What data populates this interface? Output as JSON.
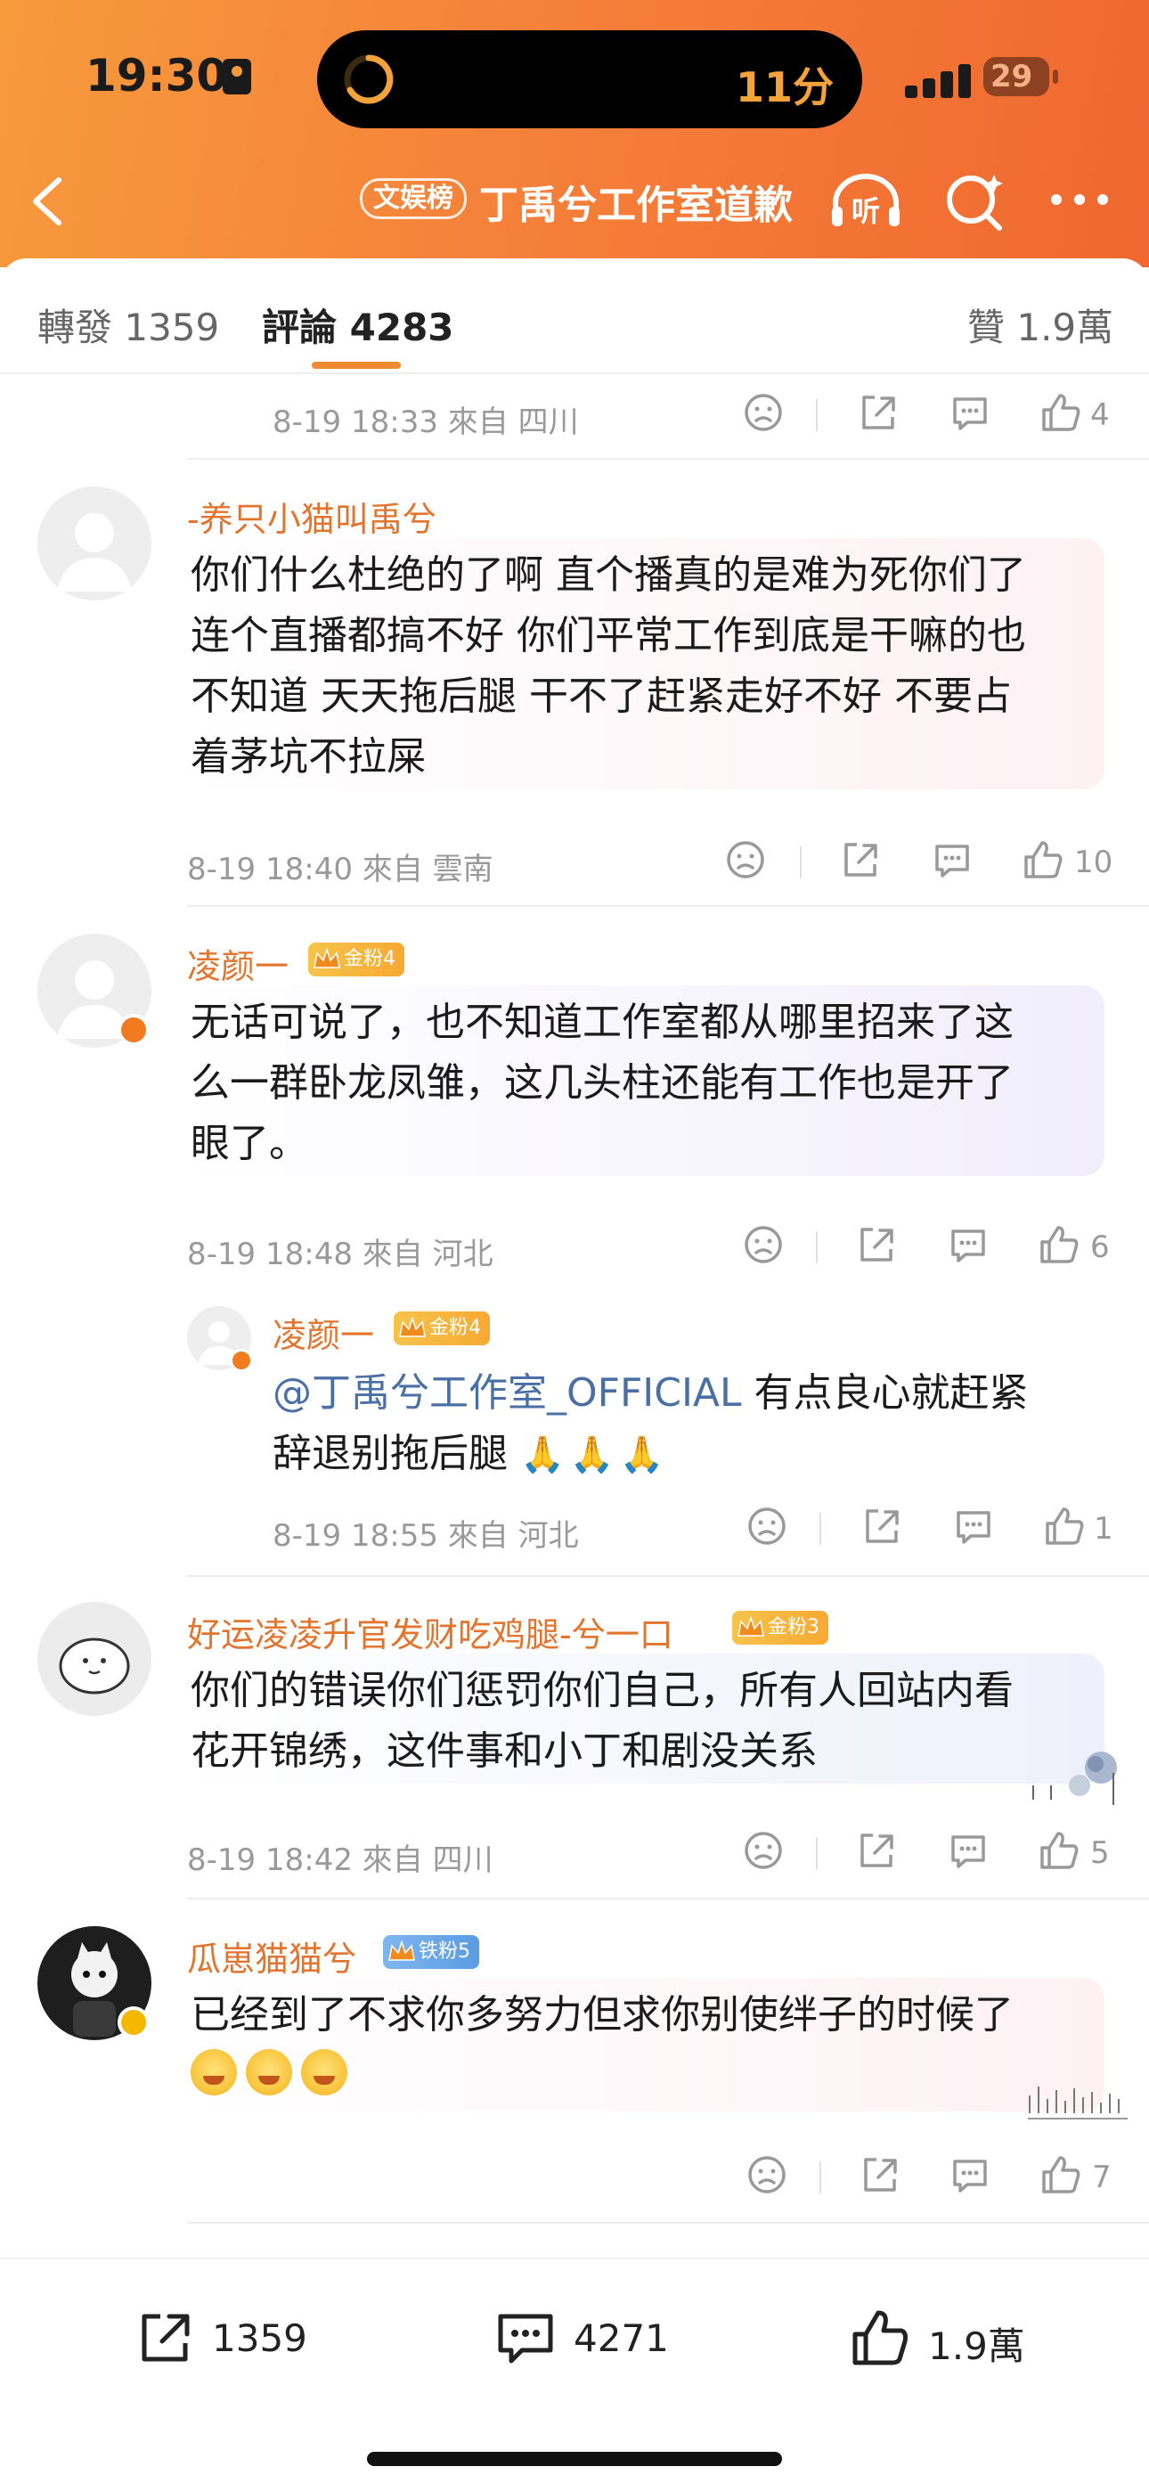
{
  "status_bar": {
    "time": "19:30",
    "island_text": "11分",
    "battery": "29"
  },
  "header": {
    "tag": "文娱榜",
    "title": "丁禹兮工作室道歉",
    "listen_label": "听"
  },
  "tabs": [
    {
      "label": "轉發 1359"
    },
    {
      "label": "評論 4283"
    },
    {
      "label": "贊 1.9萬"
    }
  ],
  "comments": [
    {
      "meta": "8-19 18:33 來自 四川",
      "likes": "4"
    },
    {
      "username": "-养只小猫叫禹兮",
      "lines": [
        "你们什么杜绝的了啊 直个播真的是难为死你们了",
        "连个直播都搞不好 你们平常工作到底是干嘛的也",
        "不知道 天天拖后腿 干不了赶紧走好不好 不要占",
        "着茅坑不拉屎"
      ],
      "meta": "8-19 18:40 來自 雲南",
      "likes": "10"
    },
    {
      "username": "凌颜一",
      "badge": "金粉4",
      "lines": [
        "无话可说了，也不知道工作室都从哪里招来了这",
        "么一群卧龙凤雏，这几头柱还能有工作也是开了",
        "眼了。"
      ],
      "meta": "8-19 18:48 來自 河北",
      "likes": "6"
    },
    {
      "username": "凌颜一",
      "badge": "金粉4",
      "mention": "@丁禹兮工作室_OFFICIAL",
      "line1_rest": " 有点良心就赶紧",
      "line2": "辞退别拖后腿",
      "meta": "8-19 18:55 來自 河北",
      "likes": "1"
    },
    {
      "username": "好运凌凌升官发财吃鸡腿-兮一口",
      "badge": "金粉3",
      "lines": [
        "你们的错误你们惩罚你们自己，所有人回站内看",
        "花开锦绣，这件事和小丁和剧没关系"
      ],
      "meta": "8-19 18:42 來自 四川",
      "likes": "5"
    },
    {
      "username": "瓜崽猫猫兮",
      "badge": "铁粉5",
      "lines": [
        "已经到了不求你多努力但求你别使绊子的时候了"
      ],
      "likes": "7"
    }
  ],
  "bottom_bar": {
    "repost_count": "1359",
    "comment_count": "4271",
    "like_count": "1.9萬"
  },
  "colors": {
    "header_gradient_start": "#f79a3c",
    "header_gradient_end": "#f0682f",
    "username": "#e3742d",
    "mention": "#4a6fa5",
    "meta_gray": "#999999"
  }
}
